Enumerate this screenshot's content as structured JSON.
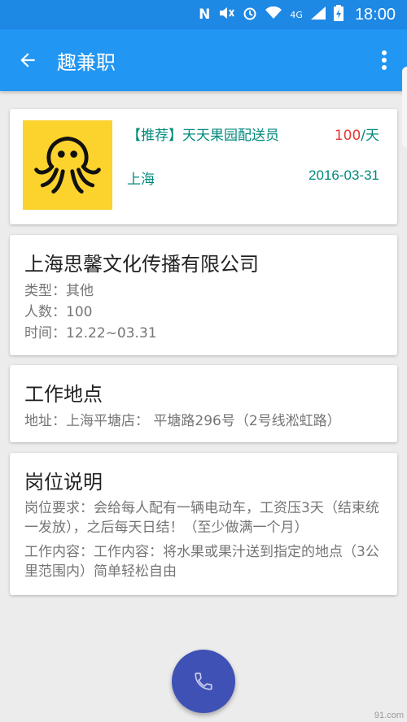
{
  "status_bar": {
    "time": "18:00",
    "network": "4G"
  },
  "app_bar": {
    "title": "趣兼职"
  },
  "job": {
    "tag_title": "【推荐】天天果园配送员",
    "pay_value": "100",
    "pay_unit": "/天",
    "city": "上海",
    "date": "2016-03-31"
  },
  "company": {
    "name": "上海思馨文化传播有限公司",
    "type_line": "类型：其他",
    "count_line": "人数：100",
    "time_line": "时间：12.22~03.31"
  },
  "location": {
    "heading": "工作地点",
    "address_line": "地址：上海平塘店： 平塘路296号（2号线淞虹路）"
  },
  "description": {
    "heading": "岗位说明",
    "requirement": "岗位要求：会给每人配有一辆电动车，工资压3天（结束统一发放），之后每天日结！（至少做满一个月）",
    "content": "工作内容：工作内容：将水果或果汁送到指定的地点（3公里范围内）简单轻松自由"
  },
  "colors": {
    "app_bar": "#2196f3",
    "status_bar": "#1e88e5",
    "fab": "#3f51b5",
    "accent_text": "#00897b",
    "pay": "#e53935",
    "logo_bg": "#fcd22c"
  },
  "icons": [
    "back-arrow-icon",
    "more-vert-icon",
    "octopus-logo-icon",
    "phone-icon"
  ],
  "watermark": "91.com"
}
